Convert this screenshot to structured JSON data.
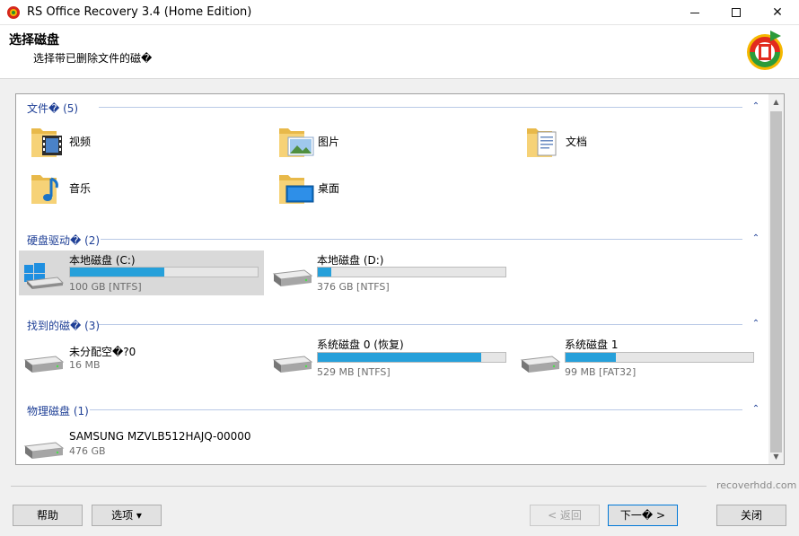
{
  "window": {
    "title": "RS Office Recovery 3.4 (Home Edition)"
  },
  "header": {
    "title": "选择磁盘",
    "subtitle": "选择带已删除文件的磁�"
  },
  "groups": {
    "files": {
      "title": "文件� (5)",
      "items": [
        {
          "label": "视频",
          "icon": "video-folder-icon"
        },
        {
          "label": "图片",
          "icon": "pictures-folder-icon"
        },
        {
          "label": "文档",
          "icon": "documents-folder-icon"
        },
        {
          "label": "音乐",
          "icon": "music-folder-icon"
        },
        {
          "label": "桌面",
          "icon": "desktop-folder-icon"
        }
      ]
    },
    "hard_drives": {
      "title": "硬盘驱动� (2)",
      "items": [
        {
          "label": "本地磁盘 (C:)",
          "size": "100 GB [NTFS]",
          "used_fraction": 0.5
        },
        {
          "label": "本地磁盘 (D:)",
          "size": "376 GB [NTFS]",
          "used_fraction": 0.07
        }
      ]
    },
    "found_disks": {
      "title": "找到的磁� (3)",
      "items": [
        {
          "label": "未分配空�?0",
          "size": "16 MB"
        },
        {
          "label": "系统磁盘 0 (恢复)",
          "size": "529 MB [NTFS]",
          "used_fraction": 0.87
        },
        {
          "label": "系统磁盘 1",
          "size": "99 MB [FAT32]",
          "used_fraction": 0.27
        }
      ]
    },
    "physical_disks": {
      "title": "物理磁盘 (1)",
      "items": [
        {
          "label": "SAMSUNG MZVLB512HAJQ-00000",
          "size": "476 GB"
        }
      ]
    }
  },
  "footer": {
    "brand": "recoverhdd.com",
    "help": "帮助",
    "options": "选项 ▾",
    "back": "< 返回",
    "next": "下一� >",
    "close": "关闭"
  },
  "colors": {
    "accent": "#26a0da",
    "group_title": "#1e3f96",
    "selected_bg": "#d9d9d9"
  }
}
